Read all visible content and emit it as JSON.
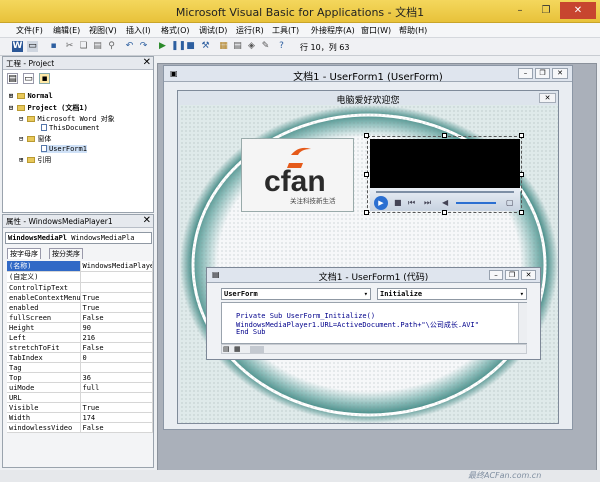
{
  "app": {
    "title": "Microsoft Visual Basic for Applications - 文档1",
    "minimize": "–",
    "restore": "❐",
    "close": "✕"
  },
  "menu": [
    "文件(F)",
    "编辑(E)",
    "视图(V)",
    "插入(I)",
    "格式(O)",
    "调试(D)",
    "运行(R)",
    "工具(T)",
    "外接程序(A)",
    "窗口(W)",
    "帮助(H)"
  ],
  "toolbar": {
    "position": "行 10，列 63"
  },
  "project": {
    "title": "工程 - Project",
    "close": "✕",
    "items": [
      "Normal",
      "Project (文档1)",
      "Microsoft Word 对象",
      "ThisDocument",
      "窗体",
      "UserForm1",
      "引用"
    ]
  },
  "properties": {
    "title": "属性 - WindowsMediaPlayer1",
    "close": "✕",
    "object_name": "WindowsMediaPl",
    "object_type": "WindowsMediaPla",
    "tabs": [
      "按字母序",
      "按分类序"
    ],
    "rows": [
      {
        "name": "(名称)",
        "value": "WindowsMediaPlaye"
      },
      {
        "name": "(自定义)",
        "value": ""
      },
      {
        "name": "ControlTipText",
        "value": ""
      },
      {
        "name": "enableContextMenu",
        "value": "True"
      },
      {
        "name": "enabled",
        "value": "True"
      },
      {
        "name": "fullScreen",
        "value": "False"
      },
      {
        "name": "Height",
        "value": "90"
      },
      {
        "name": "Left",
        "value": "216"
      },
      {
        "name": "stretchToFit",
        "value": "False"
      },
      {
        "name": "TabIndex",
        "value": "0"
      },
      {
        "name": "Tag",
        "value": ""
      },
      {
        "name": "Top",
        "value": "36"
      },
      {
        "name": "uiMode",
        "value": "full"
      },
      {
        "name": "URL",
        "value": ""
      },
      {
        "name": "Visible",
        "value": "True"
      },
      {
        "name": "Width",
        "value": "174"
      },
      {
        "name": "windowlessVideo",
        "value": "False"
      }
    ]
  },
  "userform_window": {
    "title": "文档1 - UserForm1 (UserForm)"
  },
  "form": {
    "caption": "电脑爱好欢迎您",
    "close": "✕"
  },
  "logo": {
    "brand": "cfan",
    "slogan": "关注科技新生活"
  },
  "code_window": {
    "title": "文档1 - UserForm1 (代码)",
    "object": "UserForm",
    "procedure": "Initialize",
    "lines": [
      "Private Sub UserForm_Initialize()",
      "    WindowsMediaPlayer1.URL=ActiveDocument.Path+\"\\公司成长.AVI\"",
      "End Sub"
    ]
  },
  "watermark": "最终ACFan.com.cn"
}
